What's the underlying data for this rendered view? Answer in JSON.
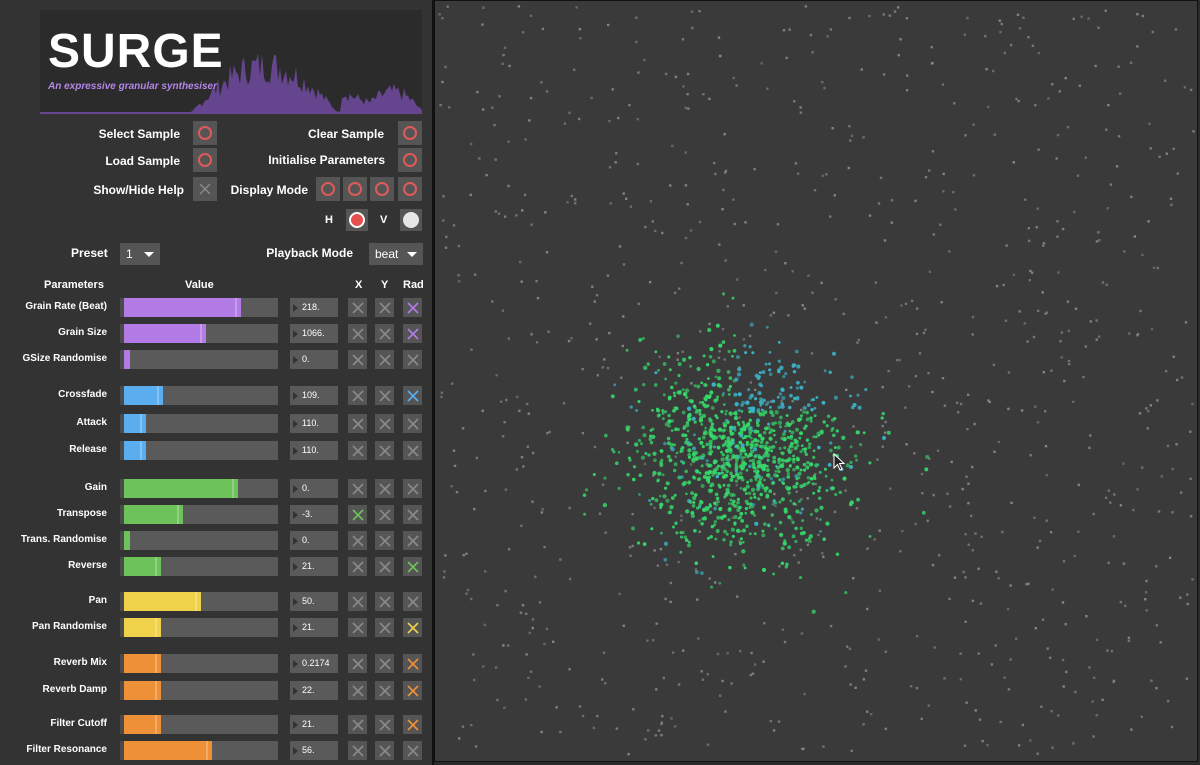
{
  "app": {
    "title": "SURGE",
    "subtitle": "An expressive granular synthesiser"
  },
  "controls": {
    "select_sample": "Select Sample",
    "clear_sample": "Clear Sample",
    "load_sample": "Load Sample",
    "initialise_parameters": "Initialise Parameters",
    "show_hide_help": "Show/Hide Help",
    "display_mode": "Display Mode",
    "h_label": "H",
    "v_label": "V",
    "preset_label": "Preset",
    "preset_value": "1",
    "playback_mode_label": "Playback Mode",
    "playback_mode_value": "beat"
  },
  "table_headers": {
    "parameters": "Parameters",
    "value": "Value",
    "x": "X",
    "y": "Y",
    "rad": "Rad"
  },
  "colors": {
    "purple": "#b37be6",
    "blue": "#5aaef0",
    "green": "#6ec25a",
    "yellow": "#f0d24a",
    "orange": "#ee9038",
    "ring_red": "#e05a5a"
  },
  "parameters": [
    {
      "name": "Grain Rate (Beat)",
      "value": "218.",
      "fill": 0.76,
      "color": "purple",
      "x": false,
      "y": false,
      "rad": true
    },
    {
      "name": "Grain Size",
      "value": "1066.",
      "fill": 0.53,
      "color": "purple",
      "x": false,
      "y": false,
      "rad": true
    },
    {
      "name": "GSize Randomise",
      "value": "0.",
      "fill": 0.04,
      "color": "purple",
      "x": false,
      "y": false,
      "rad": false
    },
    {
      "name": "Crossfade",
      "value": "109.",
      "fill": 0.25,
      "color": "blue",
      "x": false,
      "y": false,
      "rad": true
    },
    {
      "name": "Attack",
      "value": "110.",
      "fill": 0.14,
      "color": "blue",
      "x": false,
      "y": false,
      "rad": false
    },
    {
      "name": "Release",
      "value": "110.",
      "fill": 0.14,
      "color": "blue",
      "x": false,
      "y": false,
      "rad": false
    },
    {
      "name": "Gain",
      "value": "0.",
      "fill": 0.74,
      "color": "green",
      "x": false,
      "y": false,
      "rad": false
    },
    {
      "name": "Transpose",
      "value": "-3.",
      "fill": 0.38,
      "color": "green",
      "x": true,
      "y": false,
      "rad": false
    },
    {
      "name": "Trans. Randomise",
      "value": "0.",
      "fill": 0.04,
      "color": "green",
      "x": false,
      "y": false,
      "rad": false
    },
    {
      "name": "Reverse",
      "value": "21.",
      "fill": 0.24,
      "color": "green",
      "x": false,
      "y": false,
      "rad": true
    },
    {
      "name": "Pan",
      "value": "50.",
      "fill": 0.5,
      "color": "yellow",
      "x": false,
      "y": false,
      "rad": false
    },
    {
      "name": "Pan Randomise",
      "value": "21.",
      "fill": 0.24,
      "color": "yellow",
      "x": false,
      "y": false,
      "rad": true
    },
    {
      "name": "Reverb Mix",
      "value": "0.2174",
      "fill": 0.24,
      "color": "orange",
      "x": false,
      "y": false,
      "rad": true
    },
    {
      "name": "Reverb Damp",
      "value": "22.",
      "fill": 0.24,
      "color": "orange",
      "x": false,
      "y": false,
      "rad": true
    },
    {
      "name": "Filter Cutoff",
      "value": "21.",
      "fill": 0.24,
      "color": "orange",
      "x": false,
      "y": false,
      "rad": true
    },
    {
      "name": "Filter Resonance",
      "value": "56.",
      "fill": 0.57,
      "color": "orange",
      "x": false,
      "y": false,
      "rad": false
    }
  ],
  "visualizer": {
    "grain_color_main": "#35d96a",
    "grain_color_accent": "#3bb4c9",
    "background_point_color": "#8a8a8a"
  }
}
